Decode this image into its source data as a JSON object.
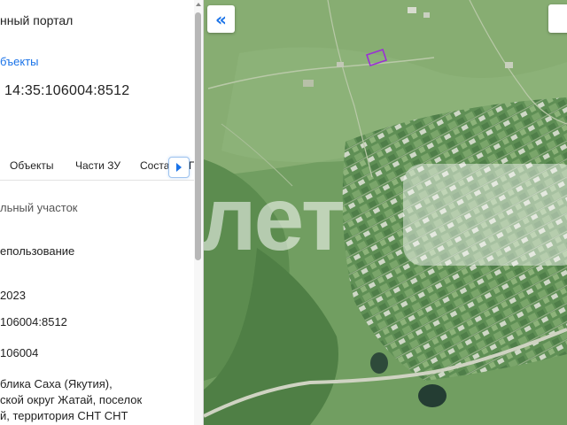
{
  "panel": {
    "portal_title": "нный портал",
    "objects_link": "бъекты",
    "cadastral_title": "14:35:106004:8512",
    "tabs": [
      {
        "label": "Объекты"
      },
      {
        "label": "Части ЗУ"
      },
      {
        "label": "Соста"
      },
      {
        "label": "П"
      }
    ],
    "next_tab_icon": "chevron-right-icon",
    "fields": {
      "object_type": "льный участок",
      "usage": "епользование",
      "date": "2023",
      "cadastral_number": "106004:8512",
      "quarter": "106004",
      "address_line1": "блика Саха (Якутия),",
      "address_line2": "ской округ Жатай, поселок",
      "address_line3": "й, территория СНТ СНТ"
    }
  },
  "map": {
    "collapse_icon": "double-chevron-left-icon",
    "collapse_label": "«",
    "watermark": "лет",
    "highlight_color": "#9b2fd6",
    "accent_color": "#1a73e8"
  }
}
